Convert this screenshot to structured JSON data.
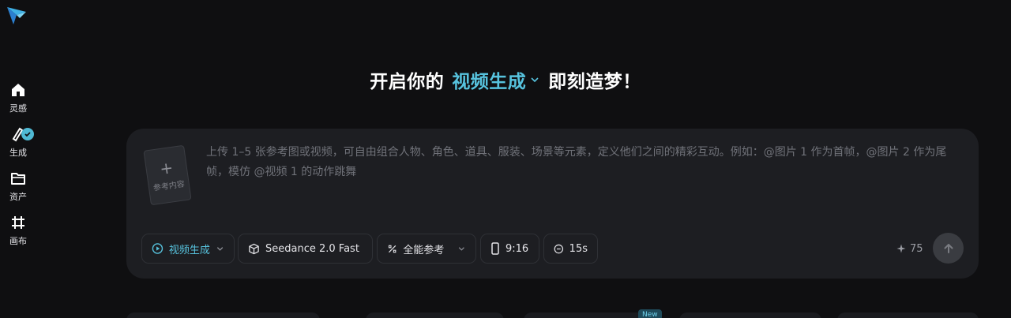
{
  "sidebar": {
    "logo_icon": "paper-plane-logo",
    "items": [
      {
        "label": "灵感",
        "icon": "home-icon"
      },
      {
        "label": "生成",
        "icon": "pen-check-icon"
      },
      {
        "label": "资产",
        "icon": "folder-icon"
      },
      {
        "label": "画布",
        "icon": "canvas-hash-icon"
      }
    ]
  },
  "headline": {
    "prefix": "开启你的",
    "mode": "视频生成",
    "suffix": "即刻造梦！"
  },
  "composer": {
    "reference_label": "参考内容",
    "reference_plus": "+",
    "prompt_placeholder": "上传 1–5 张参考图或视频，可自由组合人物、角色、道具、服装、场景等元素，定义他们之间的精彩互动。例如：@图片 1 作为首帧，@图片 2 作为尾帧，模仿 @视频 1 的动作跳舞"
  },
  "toolbar": {
    "mode_label": "视频生成",
    "model_label": "Seedance 2.0 Fast",
    "reference_mode_label": "全能参考",
    "aspect_ratio": "9:16",
    "duration": "15s",
    "credits": "75"
  },
  "bottom": {
    "new_badge": "New"
  },
  "colors": {
    "accent": "#57c3de",
    "background": "#0f0f11",
    "panel": "#1d1e22"
  }
}
